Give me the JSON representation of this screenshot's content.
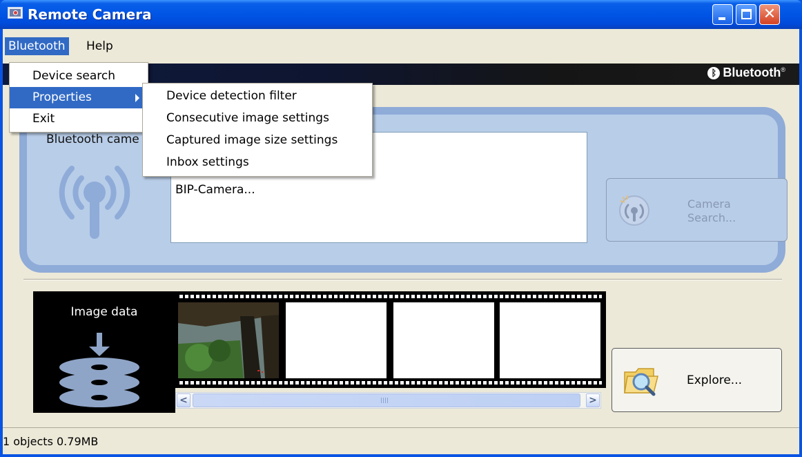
{
  "window": {
    "title": "Remote Camera"
  },
  "menubar": {
    "items": [
      "Bluetooth",
      "Help"
    ]
  },
  "banner": {
    "brand": "Bluetooth"
  },
  "camera_panel": {
    "label": "Bluetooth came",
    "devices": [
      "BIP-Camera..."
    ],
    "search_button": [
      "Camera",
      "Search..."
    ]
  },
  "image_data": {
    "label": "Image data"
  },
  "film_strip": {
    "frames": 4
  },
  "explore_button": {
    "label": "Explore..."
  },
  "status": {
    "text": "1 objects 0.79MB"
  },
  "bluetooth_menu": {
    "items": [
      {
        "label": "Device search"
      },
      {
        "label": "Properties",
        "selected": true,
        "submenu": true
      },
      {
        "label": "Exit"
      }
    ]
  },
  "properties_submenu": {
    "items": [
      {
        "label": "Device detection filter"
      },
      {
        "label": "Consecutive image settings"
      },
      {
        "label": "Captured image size settings"
      },
      {
        "label": "Inbox settings"
      }
    ]
  },
  "colors": {
    "accent": "#316ac5",
    "titlebar": "#0055e5",
    "panel": "#b8cde8"
  }
}
